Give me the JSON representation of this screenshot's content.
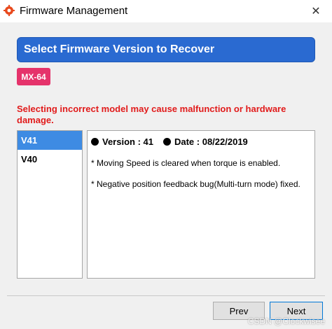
{
  "window": {
    "title": "Firmware Management",
    "close_glyph": "✕"
  },
  "header": {
    "title": "Select Firmware Version to Recover",
    "accent": "#2a6ad1"
  },
  "model_badge": {
    "label": "MX-64",
    "color": "#e5336b"
  },
  "warning": {
    "text": "Selecting incorrect model may cause malfunction or hardware damage.",
    "color": "#e11b1b"
  },
  "versions": {
    "items": [
      {
        "label": "V41",
        "selected": true
      },
      {
        "label": "V40",
        "selected": false
      }
    ]
  },
  "notes": {
    "version_text": "Version : 41",
    "date_text": "Date : 08/22/2019",
    "lines": [
      "* Moving Speed is cleared when torque is enabled.",
      "* Negative position feedback bug(Multi-turn mode) fixed."
    ]
  },
  "footer": {
    "prev_label": "Prev",
    "next_label": "Next"
  },
  "watermark": "CSDN @Clockwisee",
  "icons": {
    "app": "robot-gear-icon",
    "close": "close-icon",
    "bullet": "bullet-dot-icon"
  }
}
